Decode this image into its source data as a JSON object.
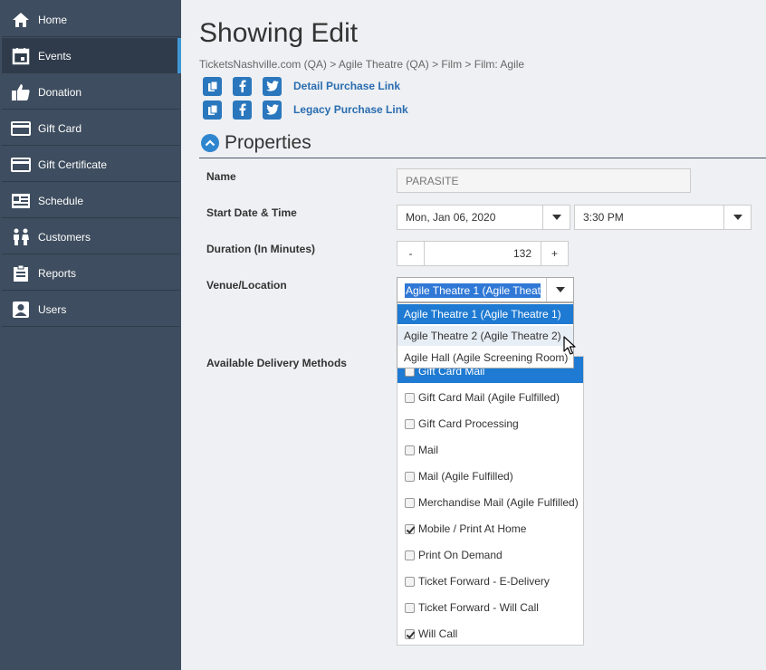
{
  "sidebar": {
    "items": [
      {
        "label": "Home",
        "icon": "home-icon"
      },
      {
        "label": "Events",
        "icon": "calendar-icon",
        "active": true
      },
      {
        "label": "Donation",
        "icon": "thumbs-up-icon"
      },
      {
        "label": "Gift Card",
        "icon": "credit-card-icon"
      },
      {
        "label": "Gift Certificate",
        "icon": "credit-card-icon"
      },
      {
        "label": "Schedule",
        "icon": "schedule-icon"
      },
      {
        "label": "Customers",
        "icon": "users-icon"
      },
      {
        "label": "Reports",
        "icon": "clipboard-icon"
      },
      {
        "label": "Users",
        "icon": "user-icon"
      }
    ]
  },
  "page": {
    "title": "Showing Edit",
    "breadcrumb": "TicketsNashville.com (QA) > Agile Theatre (QA) > Film > Film: Agile"
  },
  "share": {
    "detail_link": "Detail Purchase Link",
    "legacy_link": "Legacy Purchase Link"
  },
  "properties": {
    "title": "Properties",
    "name_label": "Name",
    "name_value": "PARASITE",
    "start_label": "Start Date & Time",
    "start_date": "Mon, Jan 06, 2020",
    "start_time": "3:30 PM",
    "duration_label": "Duration (In Minutes)",
    "duration_value": "132",
    "minus": "-",
    "plus": "+",
    "venue_label": "Venue/Location",
    "venue_selected": "Agile Theatre 1 (Agile Theatre 1)",
    "venue_options": [
      "Agile Theatre 1 (Agile Theatre 1)",
      "Agile Theatre 2 (Agile Theatre 2)",
      "Agile Hall (Agile Screening Room)"
    ],
    "delivery_label": "Available Delivery Methods",
    "delivery_methods": [
      {
        "label": "Gift Card Mail",
        "checked": false
      },
      {
        "label": "Gift Card Mail (Agile Fulfilled)",
        "checked": false
      },
      {
        "label": "Gift Card Processing",
        "checked": false
      },
      {
        "label": "Mail",
        "checked": false
      },
      {
        "label": "Mail (Agile Fulfilled)",
        "checked": false
      },
      {
        "label": "Merchandise Mail (Agile Fulfilled)",
        "checked": false
      },
      {
        "label": "Mobile / Print At Home",
        "checked": true
      },
      {
        "label": "Print On Demand",
        "checked": false
      },
      {
        "label": "Ticket Forward - E-Delivery",
        "checked": false
      },
      {
        "label": "Ticket Forward - Will Call",
        "checked": false
      },
      {
        "label": "Will Call",
        "checked": true
      }
    ]
  },
  "colors": {
    "sidebar_bg": "#3e4d5f",
    "accent": "#1e7ad2",
    "link": "#2a6db0"
  }
}
